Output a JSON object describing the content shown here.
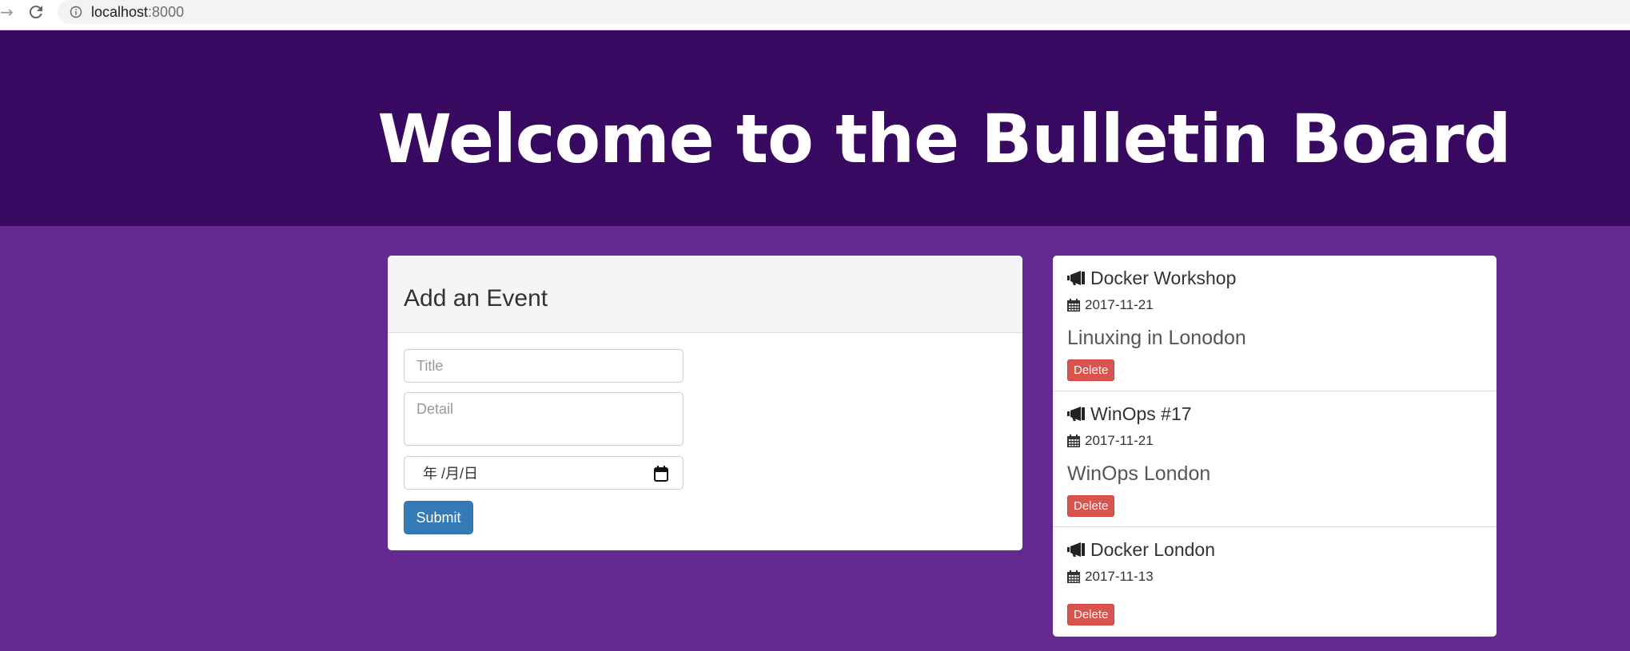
{
  "browser": {
    "url_host": "localhost",
    "url_port": ":8000"
  },
  "hero": {
    "title": "Welcome to the Bulletin Board"
  },
  "form": {
    "heading": "Add an Event",
    "title_placeholder": "Title",
    "detail_placeholder": "Detail",
    "date_placeholder": "年 /月/日",
    "submit_label": "Submit"
  },
  "events": [
    {
      "title": "Docker Workshop",
      "date": "2017-11-21",
      "detail": "Linuxing in Lonodon",
      "delete_label": "Delete"
    },
    {
      "title": "WinOps #17",
      "date": "2017-11-21",
      "detail": "WinOps London",
      "delete_label": "Delete"
    },
    {
      "title": "Docker London",
      "date": "2017-11-13",
      "detail": "",
      "delete_label": "Delete"
    }
  ],
  "colors": {
    "hero_bg": "#370960",
    "page_bg": "#642a8f",
    "primary": "#337ab7",
    "danger": "#d9534f"
  },
  "icons": {
    "event_title": "megaphone-icon",
    "event_date": "calendar-icon"
  }
}
